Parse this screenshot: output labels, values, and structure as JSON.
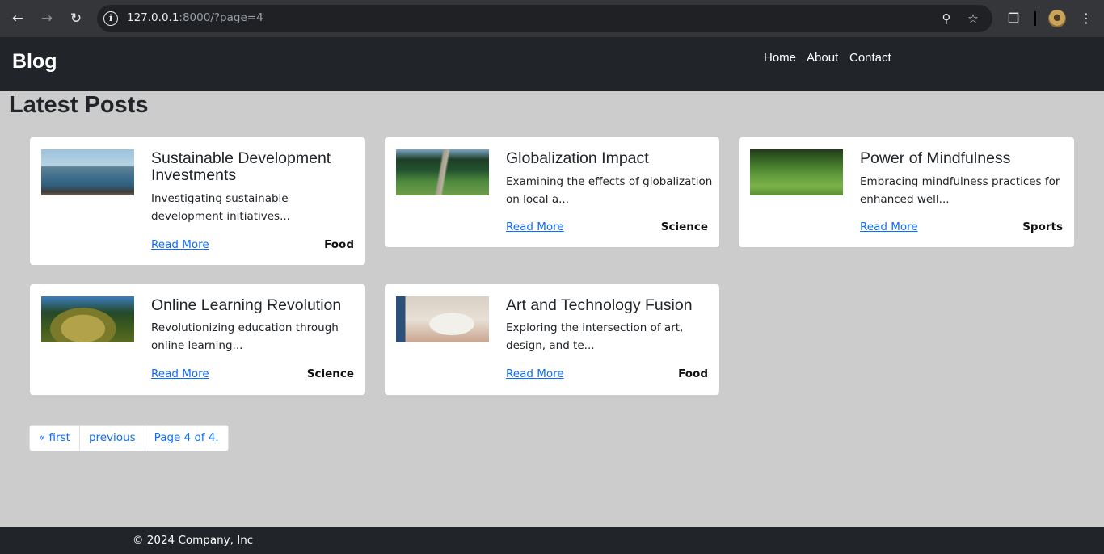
{
  "browser": {
    "url_host": "127.0.0.1",
    "url_rest": ":8000/?page=4"
  },
  "header": {
    "brand": "Blog",
    "nav": [
      "Home",
      "About",
      "Contact"
    ]
  },
  "main": {
    "title": "Latest Posts",
    "posts": [
      {
        "title": "Sustainable Development Investments",
        "excerpt": "Investigating sustainable development initiatives...",
        "link": "Read More",
        "category": "Food",
        "image": "sea-coast-photo"
      },
      {
        "title": "Globalization Impact",
        "excerpt": "Examining the effects of globalization on local a...",
        "link": "Read More",
        "category": "Science",
        "image": "forest-path-photo"
      },
      {
        "title": "Power of Mindfulness",
        "excerpt": "Embracing mindfulness practices for enhanced well...",
        "link": "Read More",
        "category": "Sports",
        "image": "grass-field-photo"
      },
      {
        "title": "Online Learning Revolution",
        "excerpt": "Revolutionizing education through online learning...",
        "link": "Read More",
        "category": "Science",
        "image": "mossy-tree-photo"
      },
      {
        "title": "Art and Technology Fusion",
        "excerpt": "Exploring the intersection of art, design, and te...",
        "link": "Read More",
        "category": "Food",
        "image": "art-desk-photo"
      }
    ],
    "pagination": [
      "« first",
      "previous",
      "Page 4 of 4."
    ]
  },
  "footer": {
    "text": "© 2024 Company, Inc"
  },
  "colors": {
    "header_bg": "#212529",
    "page_bg": "#cccccc",
    "link": "#0d6efd"
  }
}
